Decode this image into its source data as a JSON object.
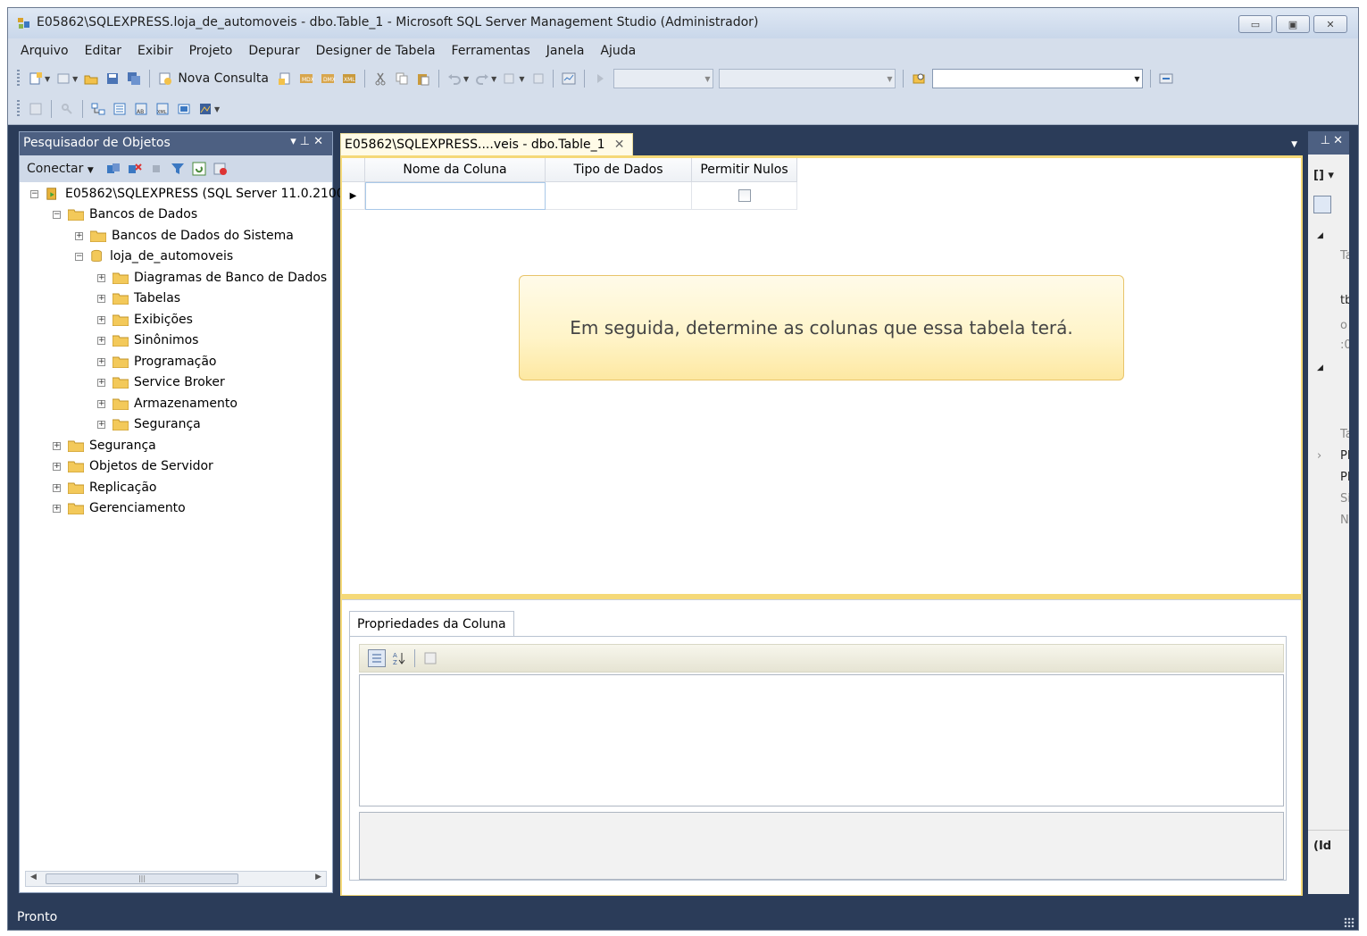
{
  "window": {
    "title": "E05862\\SQLEXPRESS.loja_de_automoveis - dbo.Table_1 - Microsoft SQL Server Management Studio (Administrador)",
    "buttons": [
      "minimize",
      "maximize",
      "close"
    ]
  },
  "menu": [
    "Arquivo",
    "Editar",
    "Exibir",
    "Projeto",
    "Depurar",
    "Designer de Tabela",
    "Ferramentas",
    "Janela",
    "Ajuda"
  ],
  "toolbar": {
    "new_query_label": "Nova Consulta"
  },
  "object_explorer": {
    "title": "Pesquisador de Objetos",
    "connect_label": "Conectar",
    "tree": [
      {
        "label": "E05862\\SQLEXPRESS (SQL Server 11.0.2100",
        "expander": "−"
      },
      {
        "label": "Bancos de Dados",
        "expander": "−"
      },
      {
        "label": "Bancos de Dados do Sistema",
        "expander": "+"
      },
      {
        "label": "loja_de_automoveis",
        "expander": "−"
      },
      {
        "label": "Diagramas de Banco de Dados",
        "expander": "+"
      },
      {
        "label": "Tabelas",
        "expander": "+"
      },
      {
        "label": "Exibições",
        "expander": "+"
      },
      {
        "label": "Sinônimos",
        "expander": "+"
      },
      {
        "label": "Programação",
        "expander": "+"
      },
      {
        "label": "Service Broker",
        "expander": "+"
      },
      {
        "label": "Armazenamento",
        "expander": "+"
      },
      {
        "label": "Segurança",
        "expander": "+"
      },
      {
        "label": "Segurança",
        "expander": "+"
      },
      {
        "label": "Objetos de Servidor",
        "expander": "+"
      },
      {
        "label": "Replicação",
        "expander": "+"
      },
      {
        "label": "Gerenciamento",
        "expander": "+"
      }
    ]
  },
  "document": {
    "tab_label": "E05862\\SQLEXPRESS....veis - dbo.Table_1",
    "columns": [
      "Nome da Coluna",
      "Tipo de Dados",
      "Permitir Nulos"
    ],
    "row": {
      "name": "",
      "type": "",
      "allow_nulls": false
    },
    "hint": "Em seguida, determine as colunas que essa tabela terá.",
    "properties_tab": "Propriedades da Coluna"
  },
  "right_pane": {
    "fragments": [
      "Ta",
      "tb",
      "o",
      ":0",
      "Ta",
      "PF",
      "PF",
      "Sil",
      "Na",
      "(Id"
    ]
  },
  "status": {
    "text": "Pronto"
  },
  "colors": {
    "frame": "#2b3c59",
    "panel_title": "#4d6082",
    "document_accent": "#f5d978"
  }
}
